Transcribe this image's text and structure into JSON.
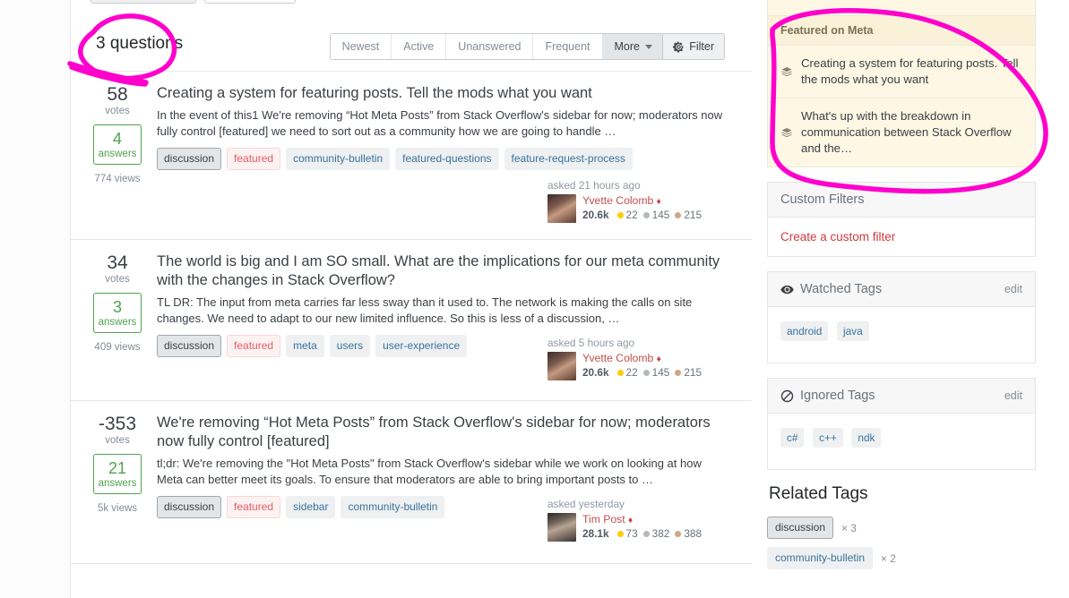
{
  "header": {
    "question_count": "3 questions",
    "tabs": [
      {
        "label": "Newest",
        "selected": false
      },
      {
        "label": "Active",
        "selected": false
      },
      {
        "label": "Unanswered",
        "selected": false
      },
      {
        "label": "Frequent",
        "selected": false
      },
      {
        "label": "More",
        "selected": true
      }
    ],
    "filter_label": "Filter"
  },
  "questions": [
    {
      "votes": "58",
      "votes_label": "votes",
      "answers": "4",
      "answers_label": "answers",
      "views": "774 views",
      "title": "Creating a system for featuring posts. Tell the mods what you want",
      "excerpt": "In the event of this1 We're removing “Hot Meta Posts” from Stack Overflow's sidebar for now; moderators now fully control [featured] we need to sort out as a community how we are going to handle …",
      "tags": [
        "discussion",
        "featured",
        "community-bulletin",
        "featured-questions",
        "feature-request-process"
      ],
      "asked": "asked 21 hours ago",
      "user": "Yvette Colomb",
      "rep": "20.6k",
      "gold": "22",
      "silver": "145",
      "bronze": "215"
    },
    {
      "votes": "34",
      "votes_label": "votes",
      "answers": "3",
      "answers_label": "answers",
      "views": "409 views",
      "title": "The world is big and I am SO small. What are the implications for our meta community with the changes in Stack Overflow?",
      "excerpt": "TL DR: The input from meta carries far less sway than it used to. The network is making the calls on site changes. We need to adapt to our new limited influence. So this is less of a discussion, …",
      "tags": [
        "discussion",
        "featured",
        "meta",
        "users",
        "user-experience"
      ],
      "asked": "asked 5 hours ago",
      "user": "Yvette Colomb",
      "rep": "20.6k",
      "gold": "22",
      "silver": "145",
      "bronze": "215"
    },
    {
      "votes": "-353",
      "votes_label": "votes",
      "answers": "21",
      "answers_label": "answers",
      "views": "5k views",
      "title": "We're removing “Hot Meta Posts” from Stack Overflow's sidebar for now; moderators now fully control [featured]",
      "excerpt": "tl;dr: We're removing the \"Hot Meta Posts\" from Stack Overflow's sidebar while we work on looking at how Meta can better meet its goals. To ensure that moderators are able to bring important posts to …",
      "tags": [
        "discussion",
        "featured",
        "sidebar",
        "community-bulletin"
      ],
      "asked": "asked yesterday",
      "user": "Tim Post",
      "rep": "28.1k",
      "gold": "73",
      "silver": "382",
      "bronze": "388"
    }
  ],
  "sidebar": {
    "featured": {
      "title": "Featured on Meta",
      "items": [
        "Creating a system for featuring posts. Tell the mods what you want",
        "What's up with the breakdown in communication between Stack Overflow and the…"
      ]
    },
    "custom_filters": {
      "title": "Custom Filters",
      "create_label": "Create a custom filter"
    },
    "watched_tags": {
      "title": "Watched Tags",
      "edit_label": "edit",
      "tags": [
        "android",
        "java"
      ]
    },
    "ignored_tags": {
      "title": "Ignored Tags",
      "edit_label": "edit",
      "tags": [
        "c#",
        "c++",
        "ndk"
      ]
    },
    "related_tags": {
      "title": "Related Tags",
      "rows": [
        {
          "tag": "discussion",
          "count": "× 3"
        },
        {
          "tag": "community-bulletin",
          "count": "× 2"
        }
      ]
    }
  },
  "colors": {
    "annotation": "#ff00cc",
    "featured_bg": "#fdf7e3",
    "green": "#4fa24f",
    "featured_tag": "#e85a62"
  }
}
